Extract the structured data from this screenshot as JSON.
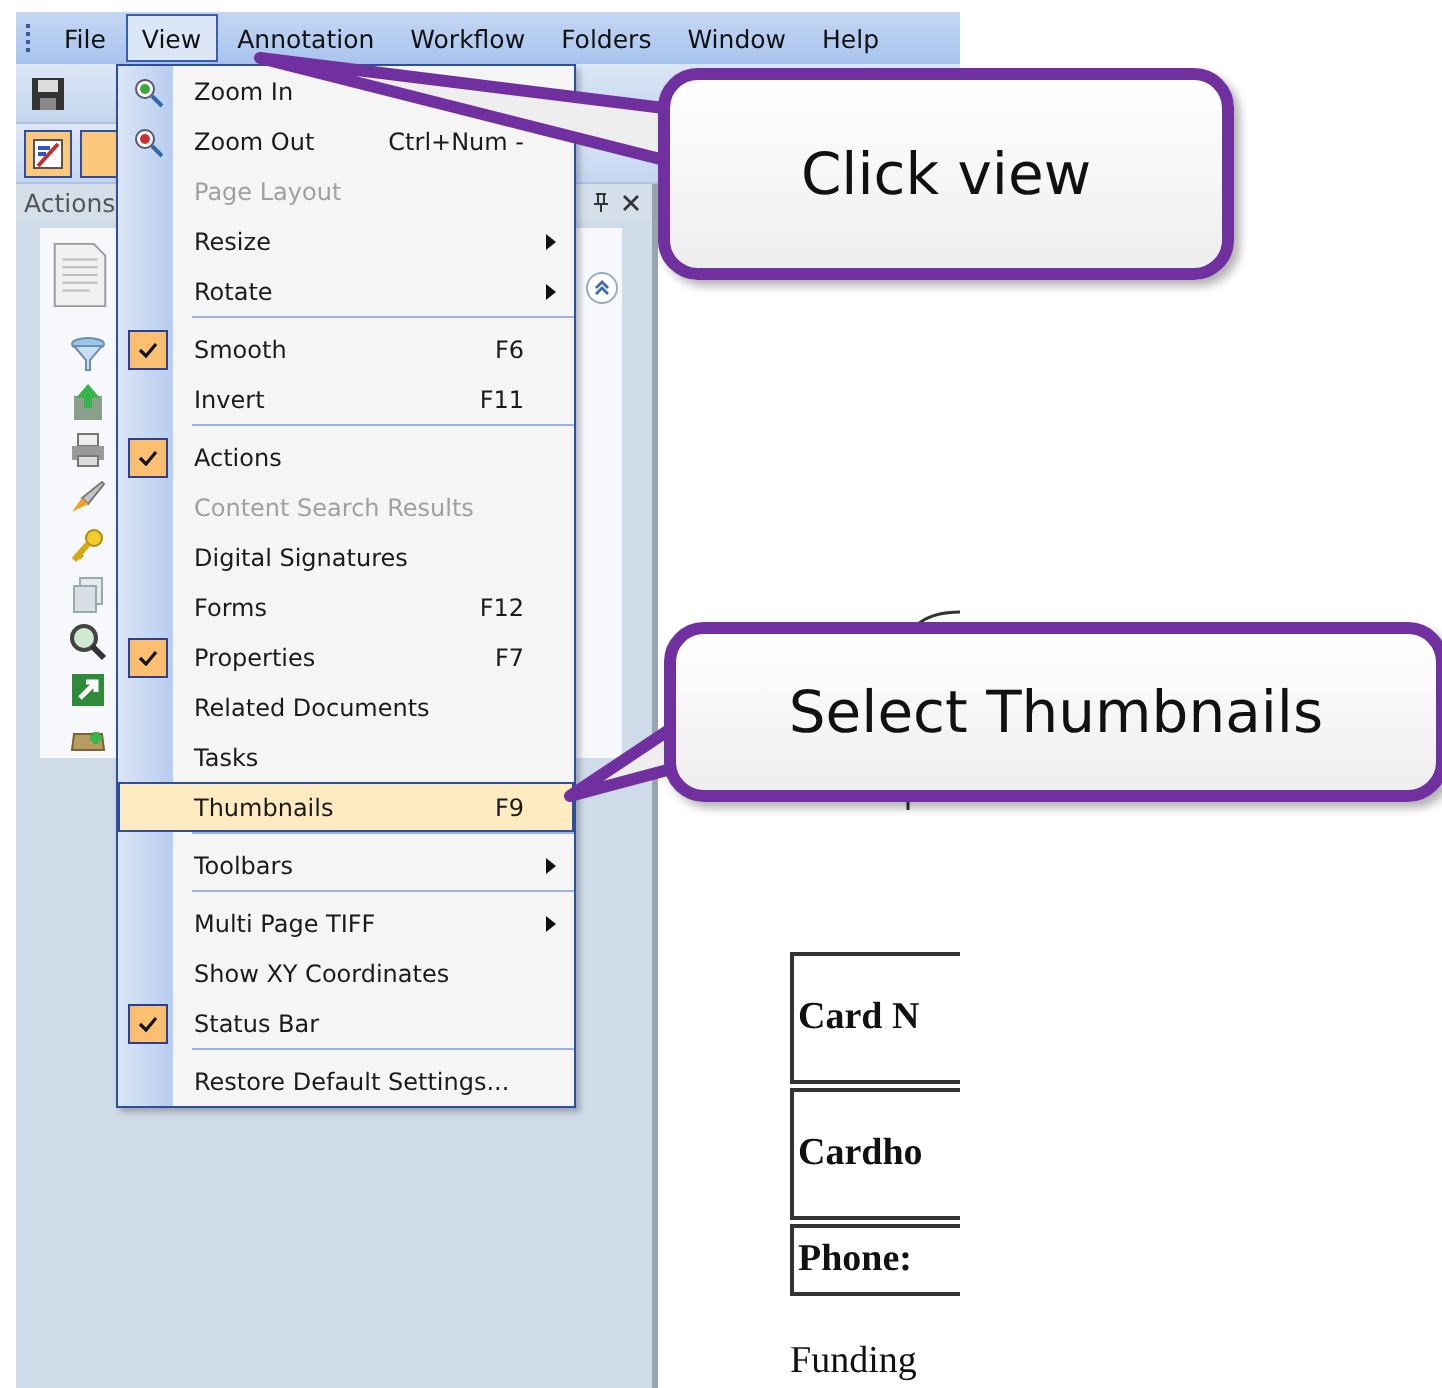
{
  "menubar": [
    {
      "label": "File",
      "selected": false
    },
    {
      "label": "View",
      "selected": true
    },
    {
      "label": "Annotation",
      "selected": false
    },
    {
      "label": "Workflow",
      "selected": false
    },
    {
      "label": "Folders",
      "selected": false
    },
    {
      "label": "Window",
      "selected": false
    },
    {
      "label": "Help",
      "selected": false
    }
  ],
  "actions_panel": {
    "title": "Actions"
  },
  "view_menu": [
    {
      "kind": "zoomin",
      "label": "Zoom In",
      "checked": false,
      "disabled": false,
      "submenu": false,
      "selected": false
    },
    {
      "kind": "zoomout",
      "label": "Zoom Out",
      "shortcut": "Ctrl+Num -",
      "checked": false,
      "disabled": false,
      "submenu": false,
      "selected": false
    },
    {
      "kind": "item",
      "label": "Page Layout",
      "checked": false,
      "disabled": true,
      "submenu": false,
      "selected": false
    },
    {
      "kind": "item",
      "label": "Resize",
      "checked": false,
      "disabled": false,
      "submenu": true,
      "selected": false
    },
    {
      "kind": "item",
      "label": "Rotate",
      "checked": false,
      "disabled": false,
      "submenu": true,
      "selected": false
    },
    {
      "kind": "separator"
    },
    {
      "kind": "item",
      "label": "Smooth",
      "shortcut": "F6",
      "checked": true,
      "disabled": false,
      "submenu": false,
      "selected": false
    },
    {
      "kind": "item",
      "label": "Invert",
      "shortcut": "F11",
      "checked": false,
      "disabled": false,
      "submenu": false,
      "selected": false
    },
    {
      "kind": "separator"
    },
    {
      "kind": "item",
      "label": "Actions",
      "checked": true,
      "disabled": false,
      "submenu": false,
      "selected": false
    },
    {
      "kind": "item",
      "label": "Content Search Results",
      "checked": false,
      "disabled": true,
      "submenu": false,
      "selected": false
    },
    {
      "kind": "item",
      "label": "Digital Signatures",
      "checked": false,
      "disabled": false,
      "submenu": false,
      "selected": false
    },
    {
      "kind": "item",
      "label": "Forms",
      "shortcut": "F12",
      "checked": false,
      "disabled": false,
      "submenu": false,
      "selected": false
    },
    {
      "kind": "item",
      "label": "Properties",
      "shortcut": "F7",
      "checked": true,
      "disabled": false,
      "submenu": false,
      "selected": false
    },
    {
      "kind": "item",
      "label": "Related Documents",
      "checked": false,
      "disabled": false,
      "submenu": false,
      "selected": false
    },
    {
      "kind": "item",
      "label": "Tasks",
      "checked": false,
      "disabled": false,
      "submenu": false,
      "selected": false
    },
    {
      "kind": "item",
      "label": "Thumbnails",
      "shortcut": "F9",
      "checked": false,
      "disabled": false,
      "submenu": false,
      "selected": true
    },
    {
      "kind": "separator"
    },
    {
      "kind": "item",
      "label": "Toolbars",
      "checked": false,
      "disabled": false,
      "submenu": true,
      "selected": false
    },
    {
      "kind": "separator"
    },
    {
      "kind": "item",
      "label": "Multi Page TIFF",
      "checked": false,
      "disabled": false,
      "submenu": true,
      "selected": false
    },
    {
      "kind": "item",
      "label": "Show XY Coordinates",
      "checked": false,
      "disabled": false,
      "submenu": false,
      "selected": false
    },
    {
      "kind": "item",
      "label": "Status Bar",
      "checked": true,
      "disabled": false,
      "submenu": false,
      "selected": false
    },
    {
      "kind": "separator"
    },
    {
      "kind": "item",
      "label": "Restore Default Settings...",
      "checked": false,
      "disabled": false,
      "submenu": false,
      "selected": false
    }
  ],
  "document": {
    "rows": [
      "Card N",
      "Cardho",
      "Phone:"
    ],
    "footer_text": "Funding"
  },
  "callouts": [
    "Click view",
    "Select Thumbnails"
  ]
}
